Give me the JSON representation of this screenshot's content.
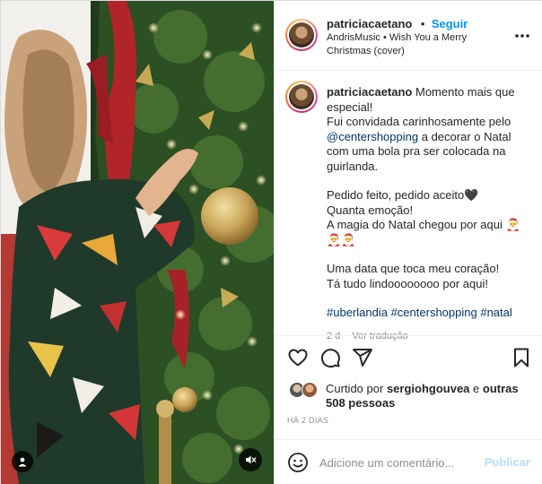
{
  "header": {
    "username": "patriciacaetano",
    "separator": "•",
    "follow_label": "Seguir",
    "music_artist": "AndrisMusic",
    "music_sep": "•",
    "music_title": "Wish You a Merry Christmas (cover)",
    "more_icon": "more-horizontal-icon"
  },
  "caption": {
    "username": "patriciacaetano",
    "line1": "Momento mais que especial!",
    "line2_a": "Fui convidada carinhosamente pelo",
    "mention": "@centershopping",
    "line2_b": "a decorar o Natal com uma bola pra ser colocada na guirlanda.",
    "line3": "Pedido feito, pedido aceito🖤",
    "line4": "Quanta emoção!",
    "line5": "A magia do Natal chegou por aqui 🎅🎅🎅",
    "line6": "Uma data que toca meu coração!",
    "line7": "Tá tudo lindoooooooo por aqui!",
    "hashtags": [
      "#uberlandia",
      "#centershopping",
      "#natal"
    ],
    "time_ago": "2 d",
    "translate_label": "Ver tradução"
  },
  "actions": {
    "like_icon": "heart-icon",
    "comment_icon": "comment-icon",
    "share_icon": "share-icon",
    "save_icon": "bookmark-icon"
  },
  "likes": {
    "prefix": "Curtido por",
    "user": "sergiohgouvea",
    "middle": "e",
    "others": "outras 508 pessoas"
  },
  "date_label": "HÁ 2 DIAS",
  "comment": {
    "placeholder": "Adicione um comentário...",
    "post_label": "Publicar"
  },
  "media": {
    "user_icon": "user-tag-icon",
    "mute_icon": "muted-speaker-icon"
  },
  "colors": {
    "accent": "#0095f6",
    "link": "#00376b",
    "muted": "#8e8e8e"
  }
}
